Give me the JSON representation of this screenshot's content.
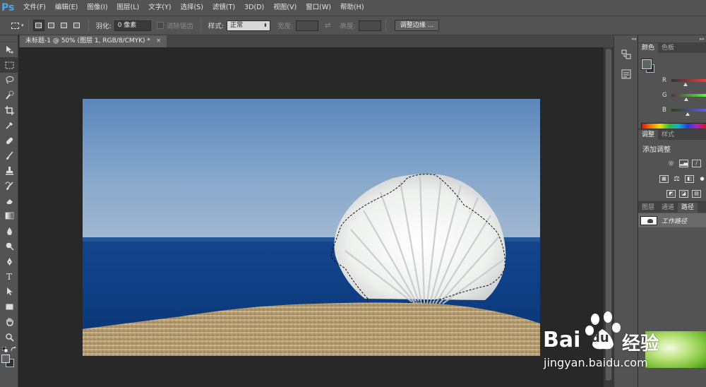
{
  "app": {
    "logo": "Ps"
  },
  "menu": [
    "文件(F)",
    "编辑(E)",
    "图像(I)",
    "图层(L)",
    "文字(Y)",
    "选择(S)",
    "滤镜(T)",
    "3D(D)",
    "视图(V)",
    "窗口(W)",
    "帮助(H)"
  ],
  "options": {
    "feather_label": "羽化:",
    "feather_value": "0 像素",
    "antialias_label": "消除锯齿",
    "style_label": "样式:",
    "style_value": "正常",
    "width_label": "宽度:",
    "height_label": "高度:",
    "refine_button": "调整边缘 ..."
  },
  "document": {
    "tab_title": "未标题-1 @ 50% (图层 1, RGB/8/CMYK) *",
    "close": "×"
  },
  "panels": {
    "color_tabs": [
      "颜色",
      "色板"
    ],
    "channels": [
      "R",
      "G",
      "B"
    ],
    "channel_levels": [
      0.38,
      0.4,
      0.45
    ],
    "adjust_tabs": [
      "调整",
      "样式"
    ],
    "adjust_title": "添加调整",
    "layer_tabs": [
      "图层",
      "通道",
      "路径"
    ],
    "path_name": "工作路径"
  },
  "watermark": {
    "logo_bai": "Bai",
    "logo_du": "du",
    "logo_jy": "经验",
    "url": "jingyan.baidu.com"
  },
  "colors": {
    "ui_bg": "#535353",
    "canvas_bg": "#282828",
    "ps_blue": "#4aa8e8"
  }
}
